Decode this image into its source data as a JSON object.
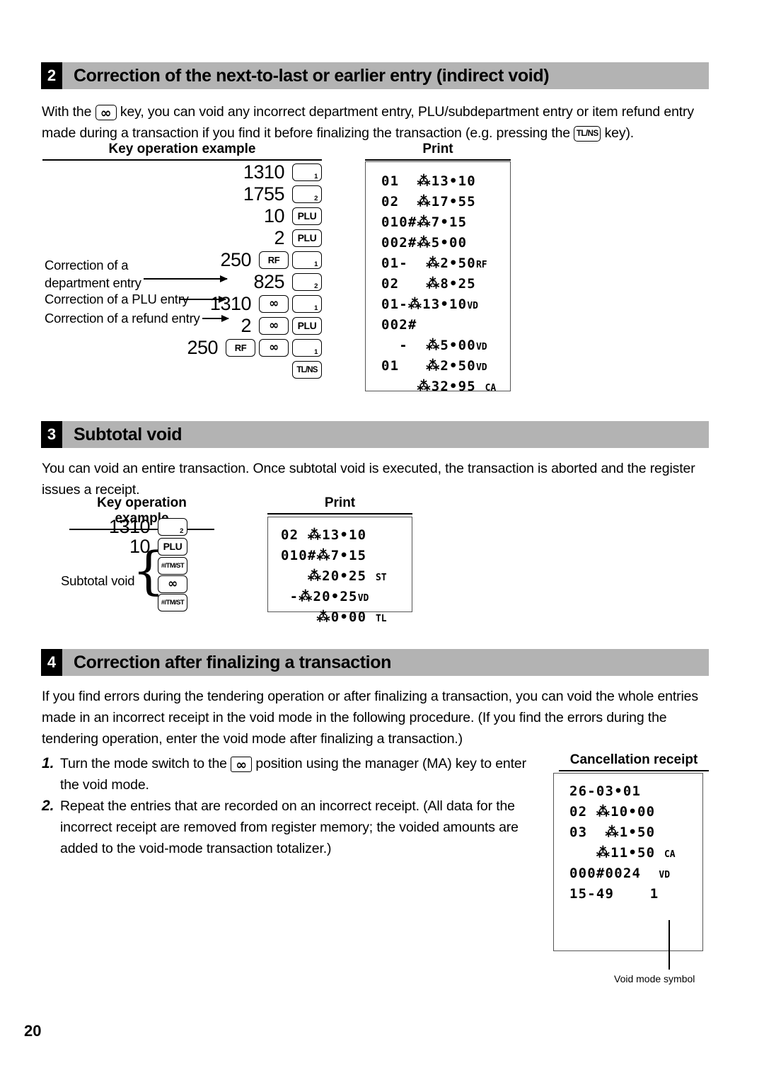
{
  "page": {
    "number": "20"
  },
  "sections": [
    {
      "num": "2",
      "title": "Correction of the next-to-last or earlier entry (indirect void)",
      "intro_a": "With the",
      "intro_b": "key, you can void any incorrect department entry, PLU/subdepartment entry or item refund entry made during a transaction if you find it before finalizing the transaction (e.g. pressing the",
      "intro_c": "key).",
      "caption_keys": "Key operation example",
      "caption_print": "Print",
      "key_rows": [
        {
          "amount": "1310",
          "keys": [
            {
              "type": "dept",
              "sub": "1"
            }
          ]
        },
        {
          "amount": "1755",
          "keys": [
            {
              "type": "dept",
              "sub": "2"
            }
          ]
        },
        {
          "amount": "10",
          "keys": [
            {
              "type": "plu",
              "label": "PLU"
            }
          ]
        },
        {
          "amount": "2",
          "keys": [
            {
              "type": "plu",
              "label": "PLU"
            }
          ]
        },
        {
          "amount": "250",
          "keys": [
            {
              "type": "rf",
              "label": "RF"
            },
            {
              "type": "dept",
              "sub": "1"
            }
          ]
        },
        {
          "amount": "825",
          "keys": [
            {
              "type": "dept",
              "sub": "2"
            }
          ]
        },
        {
          "amount": "1310",
          "keys": [
            {
              "type": "void",
              "label": "∞"
            },
            {
              "type": "dept",
              "sub": "1"
            }
          ]
        },
        {
          "amount": "2",
          "keys": [
            {
              "type": "void",
              "label": "∞"
            },
            {
              "type": "plu",
              "label": "PLU"
            }
          ]
        },
        {
          "amount": "250",
          "keys": [
            {
              "type": "rf",
              "label": "RF"
            },
            {
              "type": "void",
              "label": "∞"
            },
            {
              "type": "dept",
              "sub": "1"
            }
          ]
        },
        {
          "amount": "",
          "keys": [
            {
              "type": "tlns",
              "label": "TL/NS"
            }
          ]
        }
      ],
      "annotations": [
        {
          "line1": "Correction of a",
          "line2": "department entry"
        },
        {
          "line1": "Correction of a PLU entry",
          "line2": ""
        },
        {
          "line1": "Correction of a refund entry",
          "line2": ""
        }
      ],
      "receipt_lines": [
        {
          "text": "01  ⁂13•10",
          "mark": ""
        },
        {
          "text": "02  ⁂17•55",
          "mark": ""
        },
        {
          "text": "010#⁂7•15",
          "mark": ""
        },
        {
          "text": "002#⁂5•00",
          "mark": ""
        },
        {
          "text": "01-  ⁂2•50",
          "mark": "RF"
        },
        {
          "text": "02   ⁂8•25",
          "mark": ""
        },
        {
          "text": "01-⁂13•10",
          "mark": "VD"
        },
        {
          "text": "002#",
          "mark": ""
        },
        {
          "text": "  -  ⁂5•00",
          "mark": "VD"
        },
        {
          "text": "01   ⁂2•50",
          "mark": "VD"
        },
        {
          "text": "",
          "mark": ""
        },
        {
          "text": "    ⁂32•95 ",
          "mark": "CA"
        }
      ]
    },
    {
      "num": "3",
      "title": "Subtotal void",
      "intro": "You can void an entire transaction. Once subtotal void is executed, the transaction is aborted and the register issues a receipt.",
      "caption_keys": "Key operation example",
      "caption_print": "Print",
      "key_rows": [
        {
          "amount": "1310",
          "keys": [
            {
              "type": "dept",
              "sub": "2"
            }
          ]
        },
        {
          "amount": "10",
          "keys": [
            {
              "type": "plu",
              "label": "PLU"
            }
          ]
        },
        {
          "amount": "",
          "keys": [
            {
              "type": "tmst",
              "label": "#/TM/ST"
            }
          ]
        },
        {
          "amount": "",
          "keys": [
            {
              "type": "void",
              "label": "∞"
            }
          ]
        },
        {
          "amount": "",
          "keys": [
            {
              "type": "tmst",
              "label": "#/TM/ST"
            }
          ]
        }
      ],
      "brace_label": "Subtotal void",
      "receipt_lines": [
        {
          "text": "02 ⁂13•10",
          "mark": ""
        },
        {
          "text": "010#⁂7•15",
          "mark": ""
        },
        {
          "text": "   ⁂20•25 ",
          "mark": "ST"
        },
        {
          "text": " -⁂20•25",
          "mark": "VD"
        },
        {
          "text": "    ⁂0•00 ",
          "mark": "TL"
        }
      ]
    },
    {
      "num": "4",
      "title": "Correction after finalizing a transaction",
      "intro": "If you find errors during the tendering operation or after finalizing a transaction, you can void the whole entries made in an incorrect receipt in the void mode in the following procedure.  (If you find the errors during the tendering operation, enter the void mode after finalizing a transaction.)",
      "steps": [
        {
          "n": "1.",
          "a": "Turn the mode switch to the",
          "b": "position using the manager (MA) key to enter the void mode."
        },
        {
          "n": "2.",
          "a": "Repeat the entries that are recorded on an incorrect receipt. (All data for the incorrect receipt are removed from register memory; the voided amounts are added to the void-mode transaction totalizer.)",
          "b": ""
        }
      ],
      "caption_receipt": "Cancellation receipt",
      "receipt_lines": [
        {
          "text": "26-03•01",
          "mark": ""
        },
        {
          "text": "",
          "mark": ""
        },
        {
          "text": "02 ⁂10•00",
          "mark": ""
        },
        {
          "text": "03  ⁂1•50",
          "mark": ""
        },
        {
          "text": "",
          "mark": ""
        },
        {
          "text": "   ⁂11•50 ",
          "mark": "CA"
        },
        {
          "text": "",
          "mark": ""
        },
        {
          "text": "000#0024  ",
          "mark": "VD"
        },
        {
          "text": "15-49    1",
          "mark": ""
        }
      ],
      "callout": "Void mode symbol"
    }
  ]
}
